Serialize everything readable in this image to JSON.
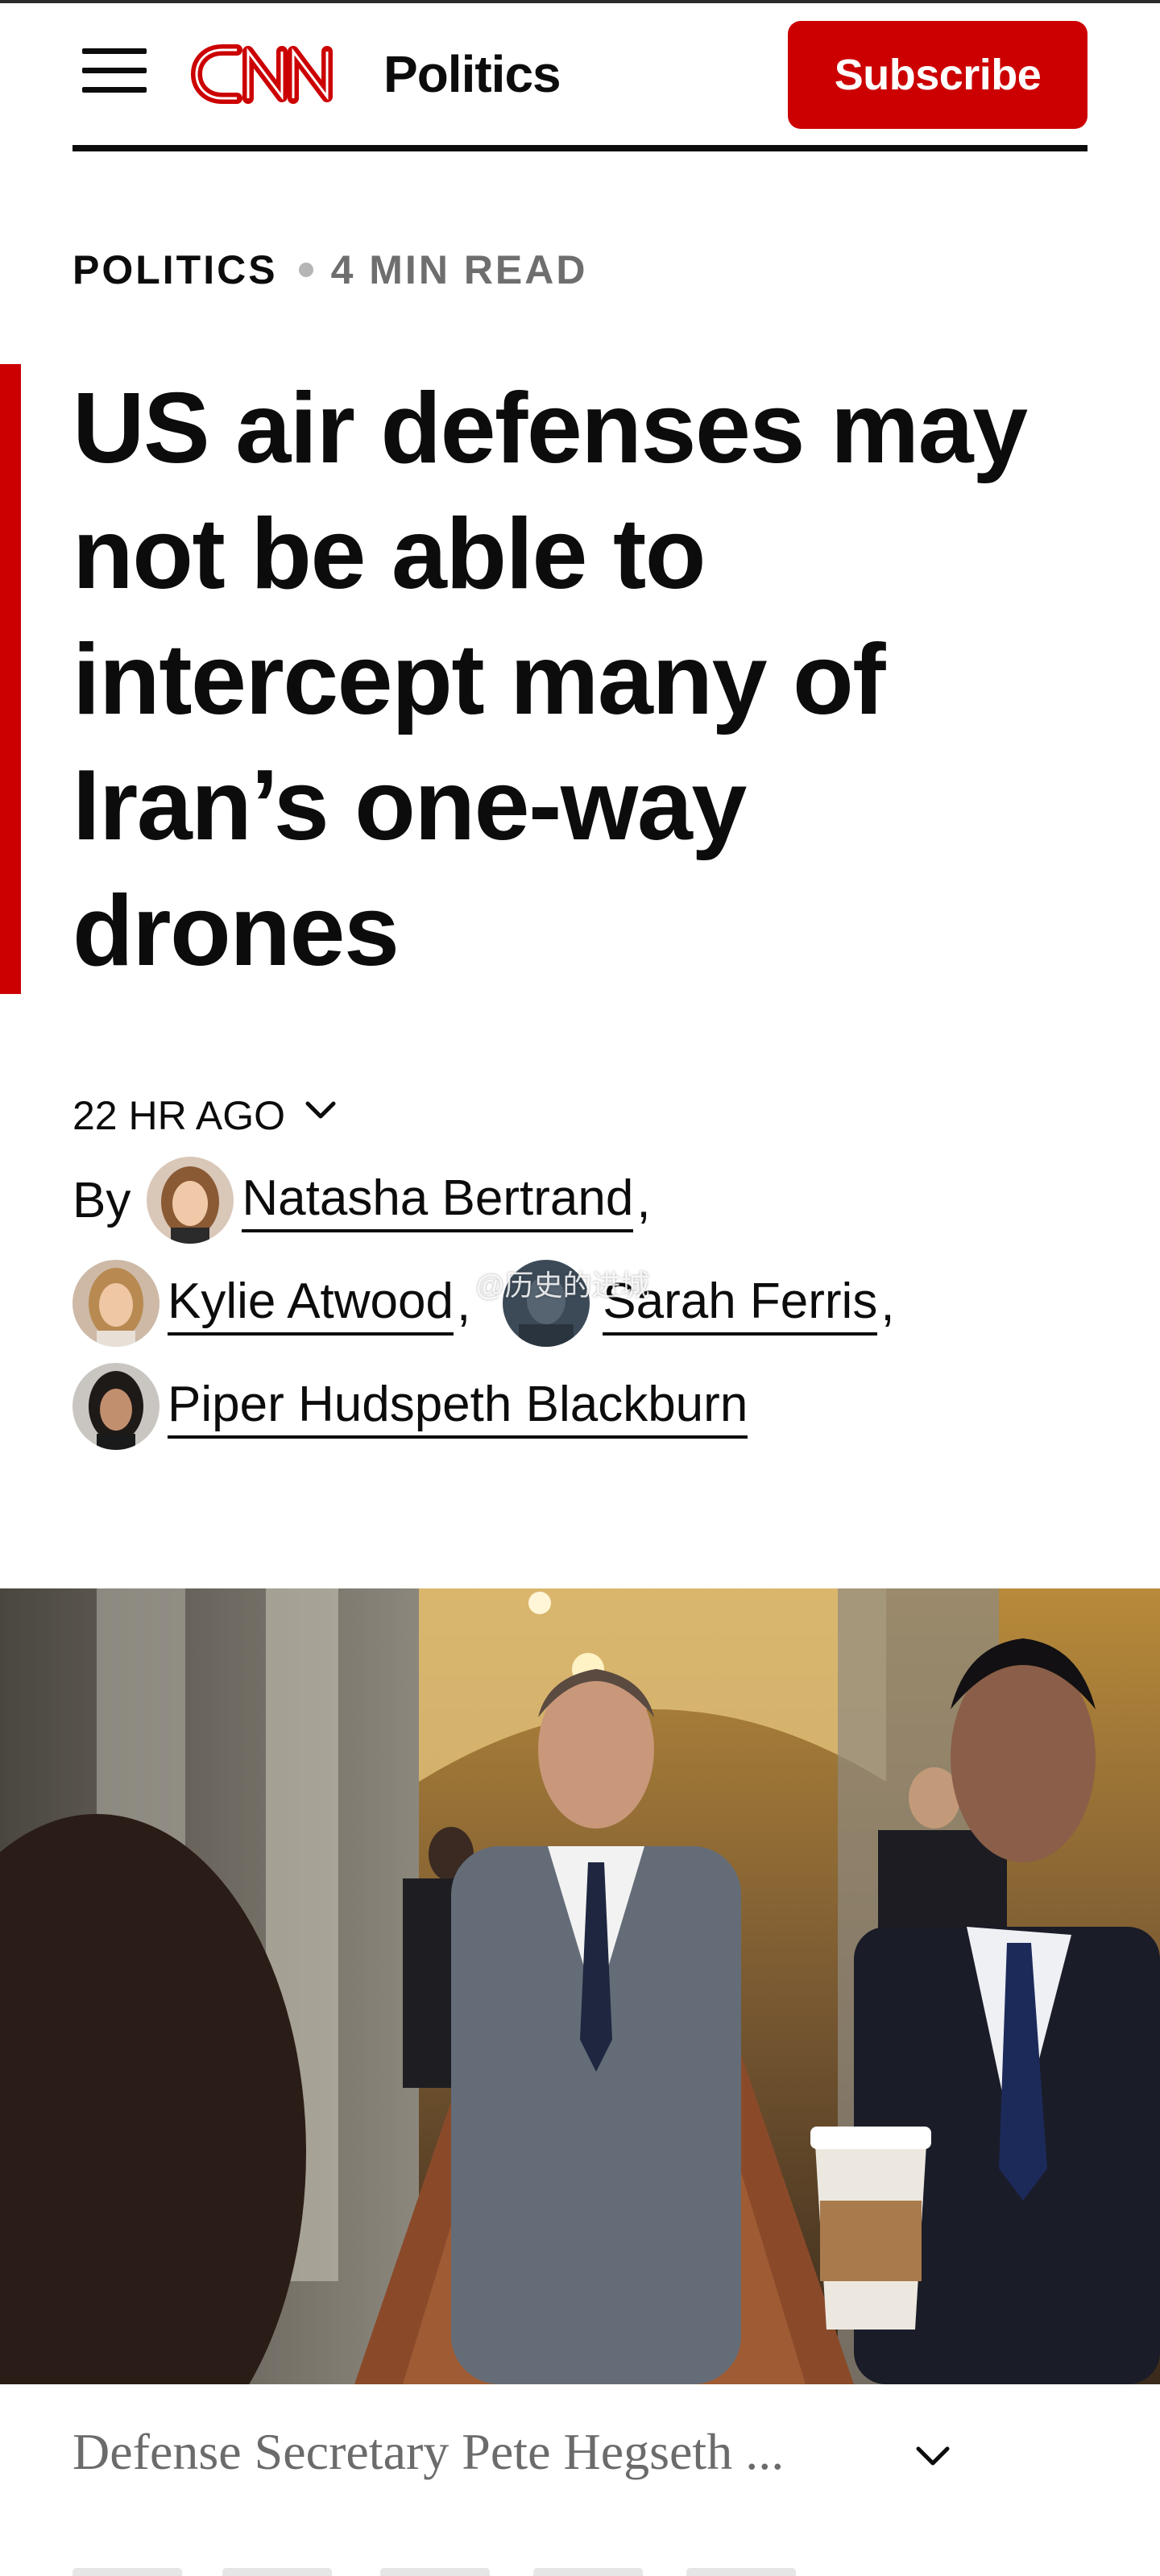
{
  "header": {
    "logo_text": "CNN",
    "section_name": "Politics",
    "subscribe_label": "Subscribe",
    "brand_color": "#cc0000"
  },
  "icons": {
    "menu": "hamburger-menu-icon",
    "timestamp_toggle": "chevron-down-icon",
    "caption_toggle": "chevron-down-icon"
  },
  "article": {
    "section": "POLITICS",
    "read_time": "4 MIN READ",
    "headline": "US air defenses may not be able to intercept many of Iran’s one-way drones",
    "timestamp": "22 HR AGO",
    "by_label": "By",
    "authors": [
      {
        "name": "Natasha Bertrand",
        "separator": ","
      },
      {
        "name": "Kylie Atwood",
        "separator": ","
      },
      {
        "name": "Sarah Ferris",
        "separator": ","
      },
      {
        "name": "Piper Hudspeth Blackburn",
        "separator": ""
      }
    ],
    "watermark": "@历史的进城",
    "image_caption": "Defense Secretary Pete Hegseth ..."
  }
}
